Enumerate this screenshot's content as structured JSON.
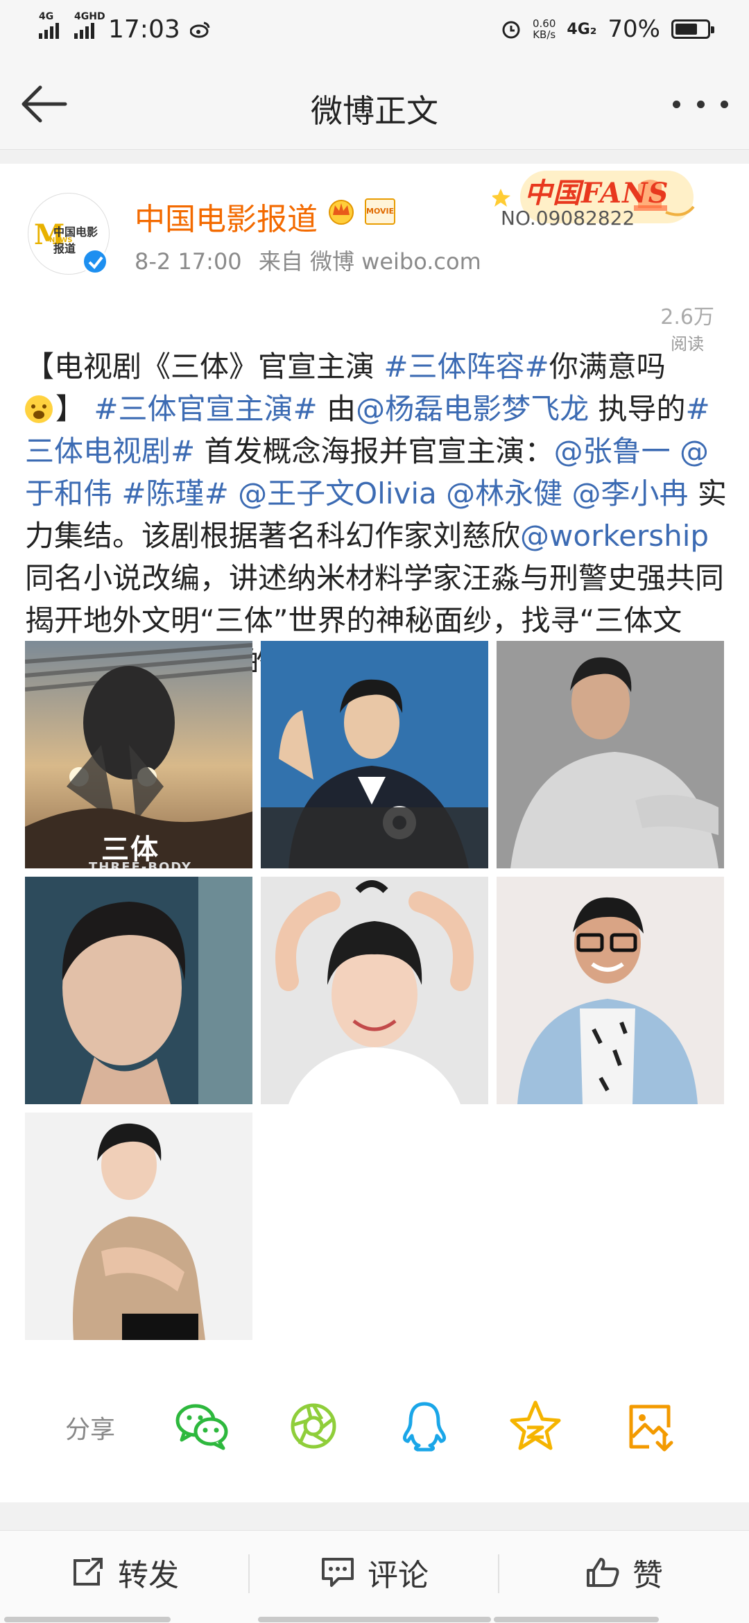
{
  "status_bar": {
    "network1": "4G",
    "network2": "4GHD",
    "time": "17:03",
    "speed_value": "0.60",
    "speed_unit": "KB/s",
    "network3": "4G₂",
    "battery": "70%",
    "battery_level": 0.7
  },
  "nav": {
    "title": "微博正文"
  },
  "post": {
    "user_name": "中国电影报道",
    "avatar_logo_text": "中国电影报道",
    "avatar_logo_sub": "NEWS",
    "movie_badge": "MOVIE",
    "date": "8-2 17:00",
    "source": "来自 微博 weibo.com",
    "fans_badge_title": "中国FANS",
    "fans_badge_no": "NO.09082822",
    "read_count": "2.6万",
    "read_label": "阅读",
    "text_runs": [
      {
        "t": "【电视剧《三体》官宣主演 ",
        "link": false
      },
      {
        "t": "#三体阵容#",
        "link": true
      },
      {
        "t": "你满意吗",
        "link": false
      },
      {
        "t": "】 ",
        "link": false
      },
      {
        "t": "#三体官宣主演#",
        "link": true
      },
      {
        "t": " 由",
        "link": false
      },
      {
        "t": "@杨磊电影梦飞龙",
        "link": true
      },
      {
        "t": " 执导的",
        "link": false
      },
      {
        "t": "#三体电视剧#",
        "link": true
      },
      {
        "t": " 首发概念海报并官宣主演：",
        "link": false
      },
      {
        "t": "@张鲁一",
        "link": true
      },
      {
        "t": " ",
        "link": false
      },
      {
        "t": "@于和伟",
        "link": true
      },
      {
        "t": " ",
        "link": false
      },
      {
        "t": "#陈瑾#",
        "link": true
      },
      {
        "t": " ",
        "link": false
      },
      {
        "t": "@王子文Olivia",
        "link": true
      },
      {
        "t": " ",
        "link": false
      },
      {
        "t": "@林永健",
        "link": true
      },
      {
        "t": " ",
        "link": false
      },
      {
        "t": "@李小冉",
        "link": true
      },
      {
        "t": " 实力集结。该剧根据著名科幻作家刘慈欣",
        "link": false
      },
      {
        "t": "@workership",
        "link": true
      },
      {
        "t": " 同名小说改编，讲述纳米材料学家汪淼与刑警史强共同揭开地外文明“三体”世界的神秘面纱，找寻“三体文明”入侵地球真相的故事。",
        "link": false
      }
    ],
    "poster_title": "三体",
    "poster_subtitle": "THREE-BODY"
  },
  "share": {
    "label": "分享",
    "targets": [
      "wechat-icon",
      "moments-icon",
      "qq-icon",
      "qzone-icon",
      "save-image-icon"
    ]
  },
  "actions": {
    "repost": "转发",
    "comment": "评论",
    "like": "赞"
  },
  "colors": {
    "link": "#3c6bb3",
    "username": "#f36a00",
    "wechat": "#2db83d",
    "moments": "#8fce3a",
    "qq": "#1aa6e8",
    "qzone": "#f5b400",
    "save": "#f39a00"
  }
}
